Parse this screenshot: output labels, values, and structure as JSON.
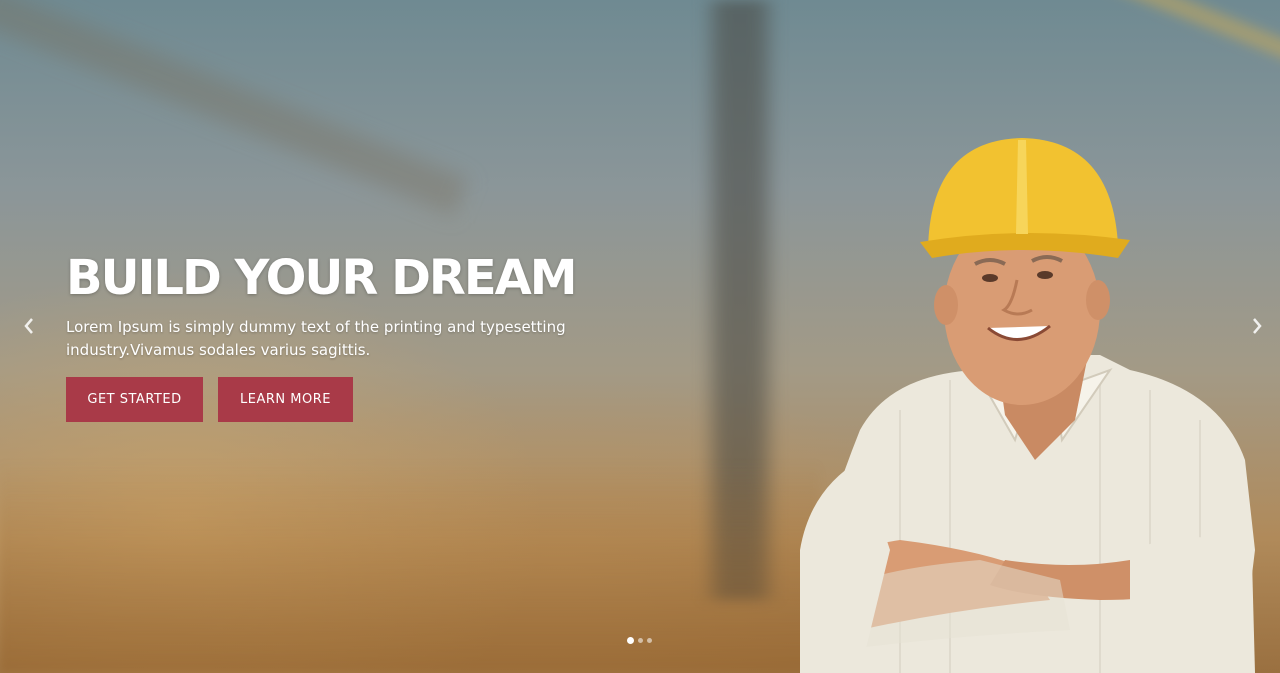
{
  "hero": {
    "title": "BUILD YOUR DREAM",
    "subtitle": "Lorem Ipsum is simply dummy text of the printing and typesetting industry.Vivamus sodales varius sagittis.",
    "buttons": {
      "primary": "GET STARTED",
      "secondary": "LEARN MORE"
    }
  },
  "slider": {
    "current_slide": 1,
    "total_slides": 3,
    "prev_icon": "chevron-left-icon",
    "next_icon": "chevron-right-icon"
  },
  "colors": {
    "button_bg": "#a93a48",
    "text": "#ffffff",
    "helmet": "#f2c230",
    "shirt": "#ece8dc"
  }
}
